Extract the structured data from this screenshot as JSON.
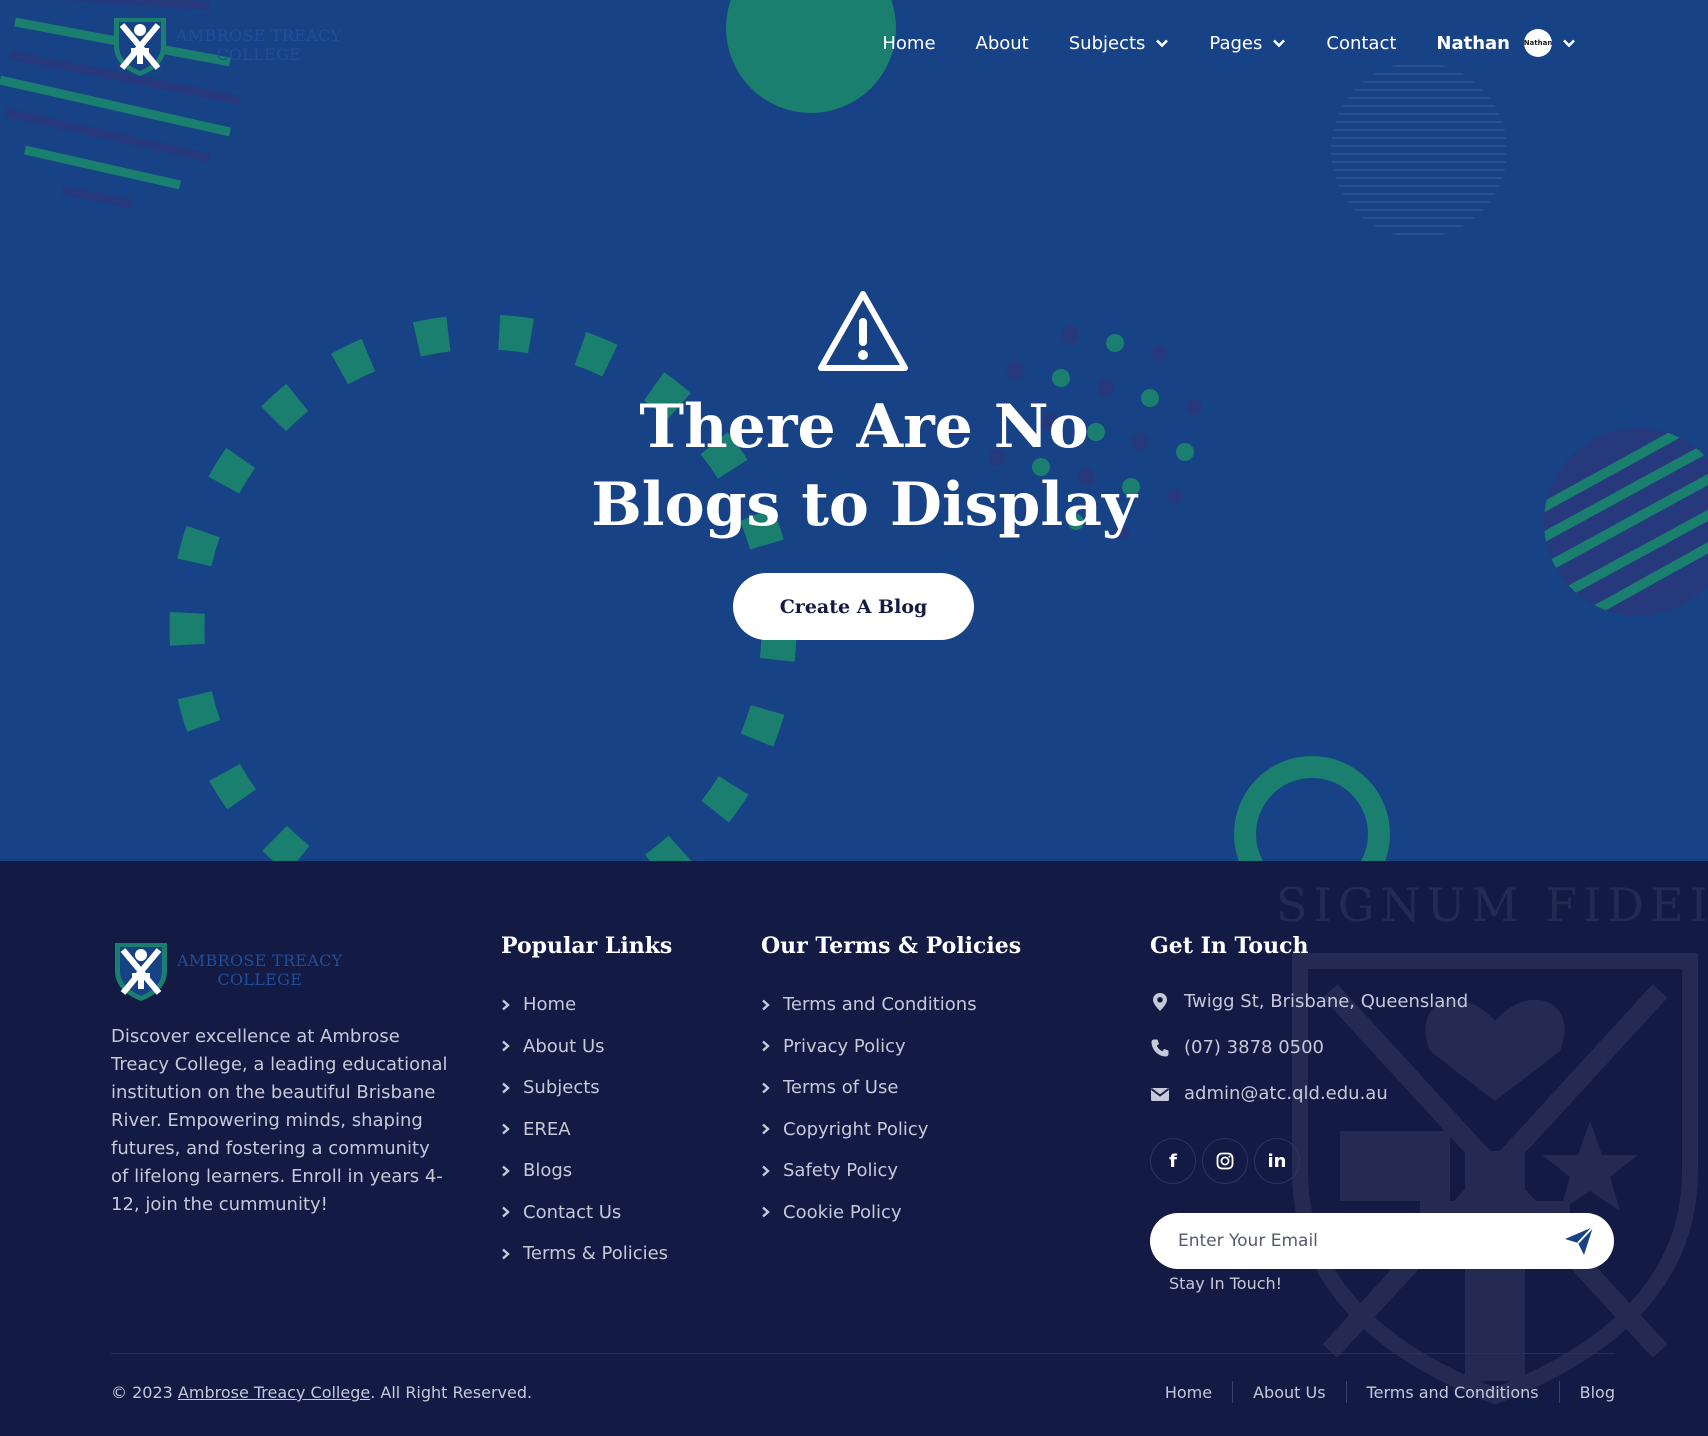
{
  "brand": {
    "name_line1": "AMBROSE TREACY",
    "name_line2": "COLLEGE"
  },
  "nav": {
    "items": [
      {
        "label": "Home"
      },
      {
        "label": "About"
      },
      {
        "label": "Subjects",
        "has_dropdown": true
      },
      {
        "label": "Pages",
        "has_dropdown": true
      },
      {
        "label": "Contact"
      }
    ],
    "user": {
      "name": "Nathan",
      "avatar_text": "Nathan"
    }
  },
  "hero": {
    "icon": "warning-triangle-icon",
    "title_line1": "There Are No",
    "title_line2": "Blogs to Display",
    "cta_label": "Create A Blog"
  },
  "footer": {
    "about_text": "Discover excellence at Ambrose Treacy College, a leading educational institution on the beautiful Brisbane River. Empowering minds, shaping futures, and fostering a community of lifelong learners. Enroll in years 4-12, join the cummunity!",
    "popular_links": {
      "title": "Popular Links",
      "items": [
        "Home",
        "About Us",
        "Subjects",
        "EREA",
        "Blogs",
        "Contact Us",
        "Terms & Policies"
      ]
    },
    "policies": {
      "title": "Our Terms & Policies",
      "items": [
        "Terms and Conditions",
        "Privacy Policy",
        "Terms of Use",
        "Copyright Policy",
        "Safety Policy",
        "Cookie Policy"
      ]
    },
    "contact": {
      "title": "Get In Touch",
      "address": "Twigg St, Brisbane, Queensland",
      "phone": "(07) 3878 0500",
      "email": "admin@atc.qld.edu.au",
      "socials": [
        {
          "icon": "facebook-icon",
          "glyph": "f"
        },
        {
          "icon": "instagram-icon",
          "glyph": ""
        },
        {
          "icon": "linkedin-icon",
          "glyph": "in"
        }
      ],
      "newsletter_placeholder": "Enter Your Email",
      "newsletter_caption": "Stay In Touch!"
    },
    "copyright_prefix": "© 2023",
    "copyright_link": "Ambrose Treacy College",
    "copyright_suffix": ". All Right Reserved.",
    "watermark_text": "SIGNUM FIDEI",
    "bottom_links": [
      "Home",
      "About Us",
      "Terms and Conditions",
      "Blog"
    ]
  },
  "colors": {
    "hero_bg": "#184286",
    "footer_bg": "#131a44",
    "accent_green": "#1a7f6e",
    "white": "#ffffff"
  }
}
